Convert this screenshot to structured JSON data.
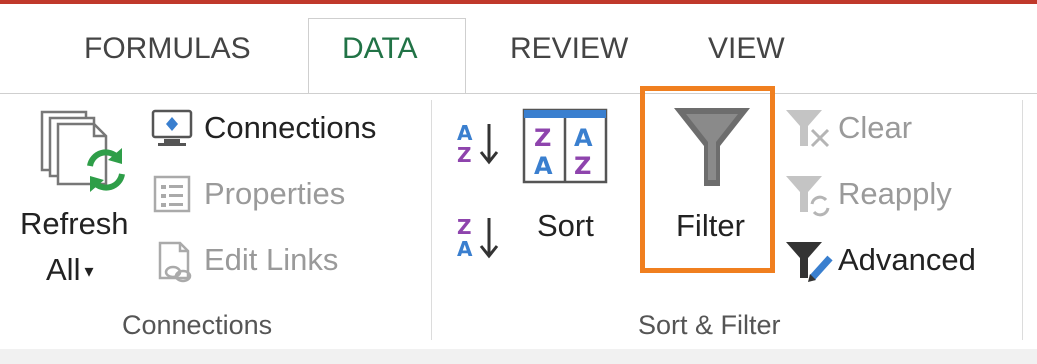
{
  "tabs": [
    {
      "label": "FORMULAS",
      "active": false
    },
    {
      "label": "DATA",
      "active": true
    },
    {
      "label": "REVIEW",
      "active": false
    },
    {
      "label": "VIEW",
      "active": false
    }
  ],
  "connections_group": {
    "refresh_all": {
      "line1": "Refresh",
      "line2": "All",
      "icon": "refresh-all-icon"
    },
    "connections": {
      "label": "Connections",
      "icon": "connections-icon",
      "enabled": true
    },
    "properties": {
      "label": "Properties",
      "icon": "properties-icon",
      "enabled": false
    },
    "edit_links": {
      "label": "Edit Links",
      "icon": "edit-links-icon",
      "enabled": false
    },
    "group_label": "Connections"
  },
  "sort_filter_group": {
    "sort_az": {
      "icon": "sort-a-to-z-icon"
    },
    "sort_za": {
      "icon": "sort-z-to-a-icon"
    },
    "sort": {
      "label": "Sort",
      "icon": "sort-dialog-icon"
    },
    "filter": {
      "label": "Filter",
      "icon": "filter-funnel-icon",
      "highlighted": true
    },
    "clear": {
      "label": "Clear",
      "icon": "clear-filter-icon",
      "enabled": false
    },
    "reapply": {
      "label": "Reapply",
      "icon": "reapply-filter-icon",
      "enabled": false
    },
    "advanced": {
      "label": "Advanced",
      "icon": "advanced-filter-icon",
      "enabled": true
    },
    "group_label": "Sort & Filter"
  },
  "colors": {
    "active_tab": "#217346",
    "highlight_border": "#f07f1f",
    "top_border": "#c0392b",
    "refresh_green": "#2e9e48"
  }
}
